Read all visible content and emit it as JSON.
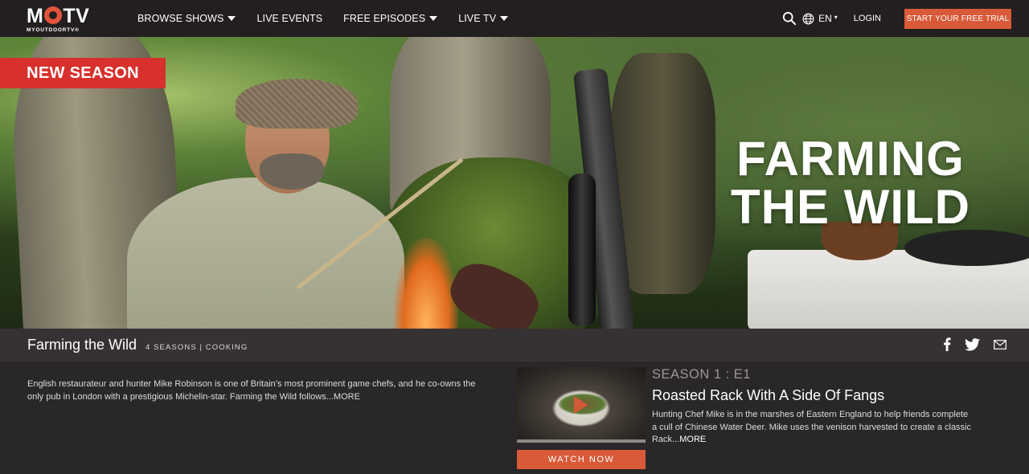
{
  "brand": {
    "logo_main_left": "M",
    "logo_main_right": "TV",
    "logo_sub": "MYOUTDOORTV®",
    "accent_color": "#d85a39"
  },
  "nav": {
    "links": [
      {
        "label": "BROWSE SHOWS",
        "has_dropdown": true
      },
      {
        "label": "LIVE EVENTS",
        "has_dropdown": false
      },
      {
        "label": "FREE EPISODES",
        "has_dropdown": true
      },
      {
        "label": "LIVE TV",
        "has_dropdown": true
      }
    ],
    "search_icon": "search-icon",
    "globe_icon": "globe-icon",
    "language": "EN",
    "language_caret": "▾",
    "login": "LOGIN",
    "cta": "START YOUR FREE TRIAL"
  },
  "hero": {
    "badge": "NEW SEASON",
    "title_line1": "FARMING",
    "title_line2": "THE WILD"
  },
  "show": {
    "title": "Farming the Wild",
    "meta": "4 SEASONS | COOKING",
    "description": "English restaurateur and hunter Mike Robinson is one of Britain’s most prominent game chefs, and he co-owns the only pub in London with a prestigious Michelin-star. Farming the Wild follows...",
    "more": "MORE",
    "social": [
      "facebook-icon",
      "twitter-icon",
      "mail-icon"
    ]
  },
  "episode": {
    "number": "SEASON 1 : E1",
    "title": "Roasted Rack With A Side Of Fangs",
    "description": "Hunting Chef Mike is in the marshes of Eastern England to help friends complete a cull of Chinese Water Deer. Mike uses the venison harvested to create a classic Rack...",
    "more": "MORE",
    "watch_label": "WATCH NOW"
  }
}
